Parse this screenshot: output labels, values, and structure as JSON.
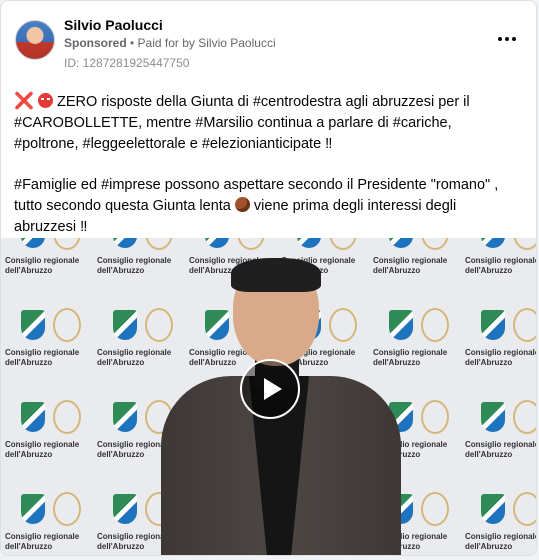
{
  "post": {
    "author": "Silvio Paolucci",
    "sponsored": "Sponsored",
    "separator": " • ",
    "paid_for": "Paid for by Silvio Paolucci",
    "id_line": "ID: 1287281925447750",
    "line1": " ZERO risposte della Giunta di #centrodestra agli abruzzesi per il #CAROBOLLETTE, mentre #Marsilio continua a parlare di #cariche, #poltrone, #leggeelettorale e #elezionianticipate ‼",
    "line2a": "#Famiglie ed #imprese possono aspettare secondo il Presidente \"romano\" , tutto secondo questa Giunta lenta ",
    "line2b": " viene prima degli interessi degli abruzzesi ‼",
    "ellipsis": "...",
    "x_icon": "❌"
  },
  "video": {
    "backdrop_label_line1": "Consiglio regionale",
    "backdrop_label_line2": "dell'Abruzzo",
    "backdrop_text": "Consiglio regionale dell'Abruzzo"
  },
  "colors": {
    "text": "#050505",
    "meta": "#65676b",
    "border": "#dddfe2"
  },
  "icons": [
    "cross-mark-icon",
    "angry-face-icon",
    "snail-icon",
    "more-options-icon",
    "play-icon"
  ]
}
